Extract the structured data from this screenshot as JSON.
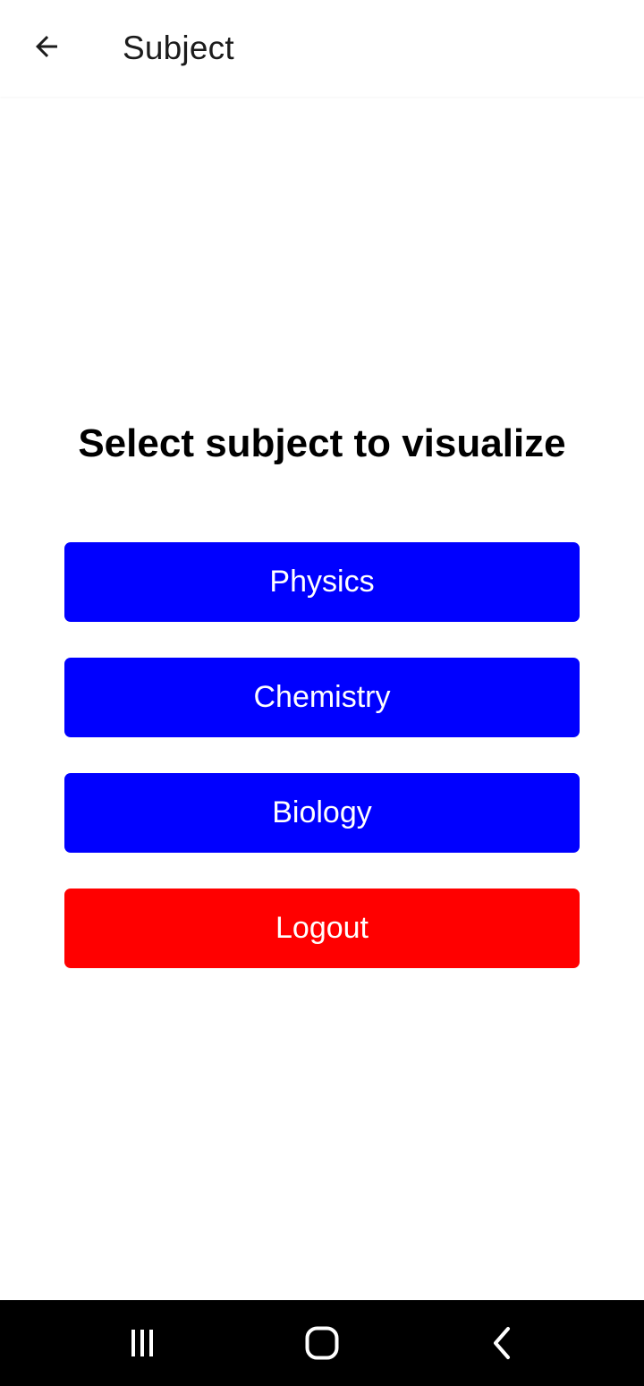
{
  "header": {
    "title": "Subject",
    "back_icon": "arrow-left-icon"
  },
  "main": {
    "heading": "Select subject to visualize",
    "buttons": [
      {
        "label": "Physics",
        "color": "#0000ff"
      },
      {
        "label": "Chemistry",
        "color": "#0000ff"
      },
      {
        "label": "Biology",
        "color": "#0000ff"
      },
      {
        "label": "Logout",
        "color": "#ff0000"
      }
    ]
  },
  "system_nav": {
    "recents_icon": "recents-icon",
    "home_icon": "home-icon",
    "back_icon": "chevron-left-icon"
  }
}
